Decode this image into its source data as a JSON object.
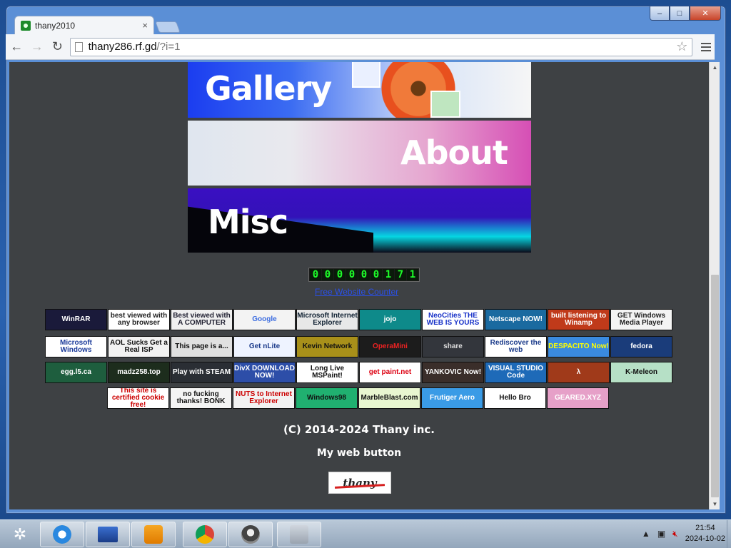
{
  "window": {
    "controls": [
      "–",
      "□",
      "✕"
    ]
  },
  "tab": {
    "title": "thany2010",
    "close": "×"
  },
  "toolbar": {
    "back": "←",
    "forward": "→",
    "reload": "↻",
    "url_host": "thany286.rf.gd",
    "url_path": "/?i=1",
    "star": "☆"
  },
  "nav_banners": [
    {
      "label": "Gallery"
    },
    {
      "label": "About"
    },
    {
      "label": "Misc"
    }
  ],
  "counter": {
    "digits": [
      "0",
      "0",
      "0",
      "0",
      "0",
      "0",
      "1",
      "7",
      "1"
    ],
    "link": "Free Website Counter"
  },
  "buttons": {
    "row1": [
      "WinRAR",
      "best viewed with any browser",
      "Best viewed with A COMPUTER",
      "Google",
      "Microsoft Internet Explorer",
      "jojo",
      "NeoCities THE WEB IS YOURS",
      "Netscape NOW!",
      "built listening to Winamp",
      "GET Windows Media Player"
    ],
    "row2": [
      "Microsoft Windows",
      "AOL Sucks Get a Real ISP",
      "This page is a...",
      "Get nLite",
      "Kevin Network",
      "OperaMini",
      "share",
      "Rediscover the web",
      "DESPACITO Now!",
      "fedora"
    ],
    "row3": [
      "egg.l5.ca",
      "madz258.top",
      "Play with STEAM",
      "DivX DOWNLOAD NOW!",
      "Long Live MSPaint!",
      "get paint.net",
      "YANKOVIC Now!",
      "VISUAL STUDIO Code",
      "λ",
      "K-Meleon"
    ],
    "row4": [
      "This site is certified cookie free!",
      "no fucking thanks! BONK",
      "NUTS to Internet Explorer",
      "Windows98",
      "MarbleBlast.com",
      "Frutiger Aero",
      "Hello Bro",
      "GEARED.XYZ"
    ]
  },
  "footer": {
    "copyright": "(C) 2014-2024 Thany inc.",
    "my_button_label": "My web button",
    "my_button_text": "thany"
  },
  "taskbar": {
    "time": "21:54",
    "date": "2024-10-02"
  },
  "colors": {
    "page_bg": "#3e4144",
    "link": "#2a50e8",
    "counter_digit": "#1eff2a"
  }
}
